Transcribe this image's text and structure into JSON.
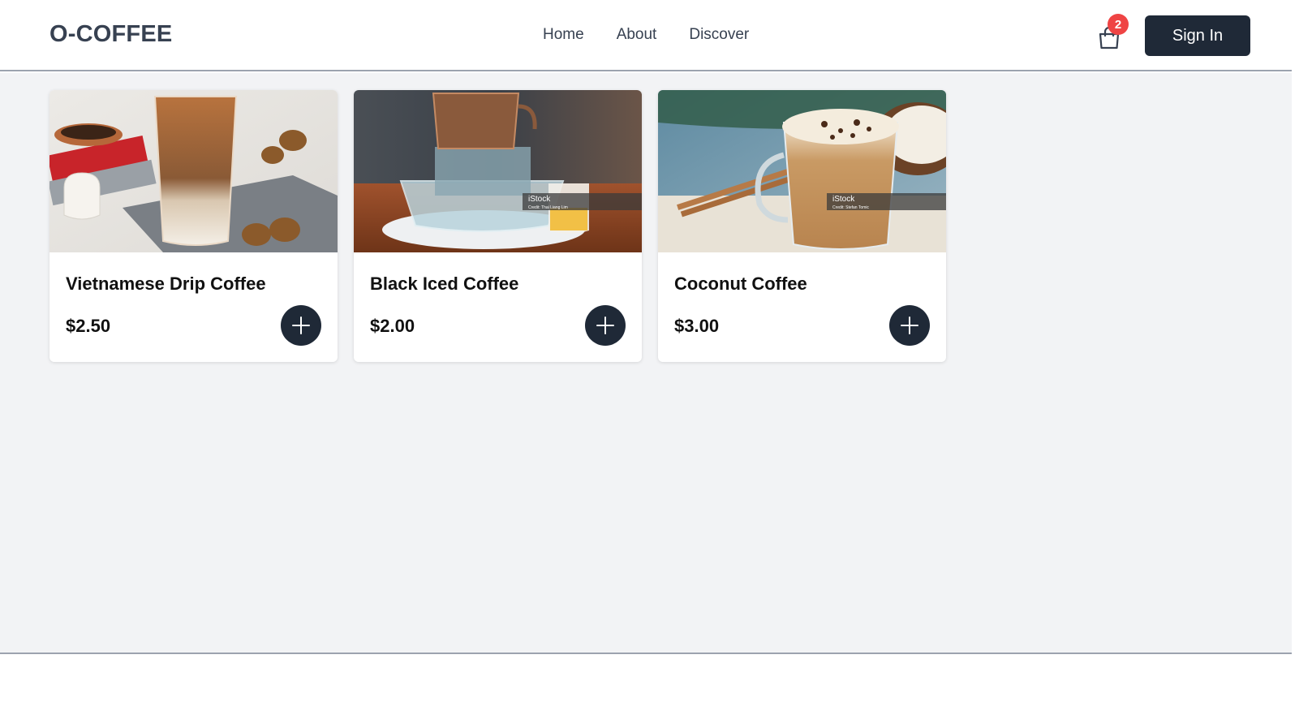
{
  "header": {
    "logo": "O-COFFEE",
    "nav": [
      "Home",
      "About",
      "Discover"
    ],
    "cart_count": "2",
    "sign_in_label": "Sign In"
  },
  "products": [
    {
      "name": "Vietnamese Drip Coffee",
      "price": "$2.50",
      "image": "iced-coffee-with-milk-photo"
    },
    {
      "name": "Black Iced Coffee",
      "price": "$2.00",
      "image": "phin-filter-drip-photo",
      "watermark": "iStock",
      "credit": "Credit: Thai Liang Lim"
    },
    {
      "name": "Coconut Coffee",
      "price": "$3.00",
      "image": "coconut-coffee-glass-photo",
      "watermark": "iStock",
      "credit": "Credit: Stefan Tomic"
    }
  ],
  "colors": {
    "brand_dark": "#1f2937",
    "badge": "#ef4444",
    "page_bg": "#f2f3f5"
  }
}
